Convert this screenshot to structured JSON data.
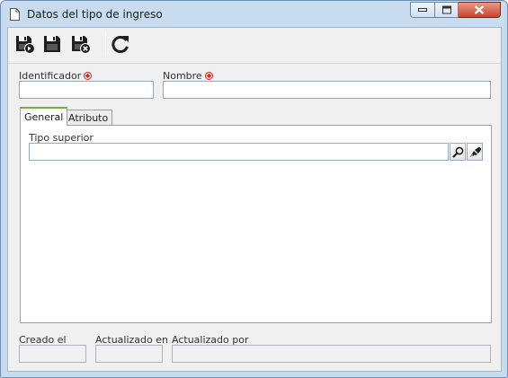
{
  "window": {
    "title": "Datos del tipo de ingreso"
  },
  "toolbar": {
    "buttons": [
      "save-and-new",
      "save",
      "save-and-close",
      "refresh"
    ]
  },
  "form": {
    "identificador_label": "Identificador",
    "identificador_value": "",
    "nombre_label": "Nombre",
    "nombre_value": ""
  },
  "tabs": [
    {
      "label": "General",
      "active": true
    },
    {
      "label": "Atributo",
      "active": false
    }
  ],
  "general": {
    "tipo_superior_label": "Tipo superior",
    "tipo_superior_value": ""
  },
  "footer": {
    "creado_el_label": "Creado el",
    "creado_el_value": "",
    "actualizado_en_label": "Actualizado en",
    "actualizado_en_value": "",
    "actualizado_por_label": "Actualizado por",
    "actualizado_por_value": ""
  },
  "colors": {
    "required_marker": "#d9291c",
    "active_tab_accent": "#6fb24a",
    "close_button": "#c9452b"
  }
}
